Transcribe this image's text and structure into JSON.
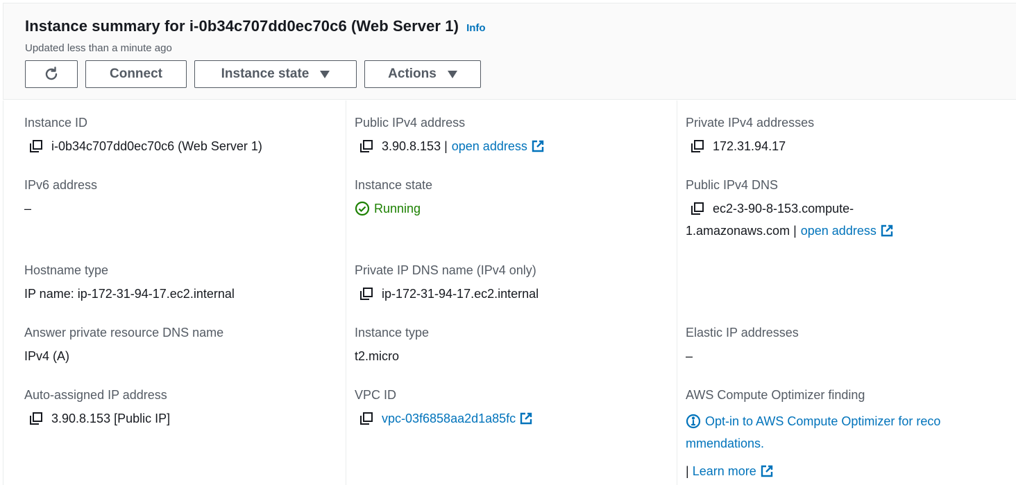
{
  "header": {
    "title": "Instance summary for i-0b34c707dd0ec70c6 (Web Server 1)",
    "info_label": "Info",
    "updated_text": "Updated less than a minute ago",
    "buttons": {
      "refresh_icon": "refresh-icon",
      "connect": "Connect",
      "instance_state": "Instance state",
      "actions": "Actions"
    }
  },
  "details": {
    "instance_id": {
      "label": "Instance ID",
      "value": "i-0b34c707dd0ec70c6 (Web Server 1)"
    },
    "public_ipv4": {
      "label": "Public IPv4 address",
      "value": "3.90.8.153 |",
      "link": "open address"
    },
    "private_ipv4": {
      "label": "Private IPv4 addresses",
      "value": "172.31.94.17"
    },
    "ipv6": {
      "label": "IPv6 address",
      "value": "–"
    },
    "instance_state": {
      "label": "Instance state",
      "value": "Running"
    },
    "public_dns": {
      "label": "Public IPv4 DNS",
      "value_line1": "ec2-3-90-8-153.compute-",
      "value_line2": "1.amazonaws.com |",
      "link": "open address"
    },
    "hostname_type": {
      "label": "Hostname type",
      "value": "IP name: ip-172-31-94-17.ec2.internal"
    },
    "private_dns": {
      "label": "Private IP DNS name (IPv4 only)",
      "value": "ip-172-31-94-17.ec2.internal"
    },
    "answer_dns": {
      "label": "Answer private resource DNS name",
      "value": "IPv4 (A)"
    },
    "instance_type": {
      "label": "Instance type",
      "value": "t2.micro"
    },
    "elastic_ip": {
      "label": "Elastic IP addresses",
      "value": "–"
    },
    "auto_ip": {
      "label": "Auto-assigned IP address",
      "value": "3.90.8.153 [Public IP]"
    },
    "vpc_id": {
      "label": "VPC ID",
      "value": "vpc-03f6858aa2d1a85fc"
    },
    "optimizer": {
      "label": "AWS Compute Optimizer finding",
      "link_line1": "Opt-in to AWS Compute Optimizer for reco",
      "link_line2": "mmendations.",
      "separator": "|",
      "learn_more": "Learn more"
    }
  },
  "colors": {
    "link": "#0073bb",
    "running": "#1d8102",
    "label": "#545b64",
    "text": "#16191f"
  }
}
